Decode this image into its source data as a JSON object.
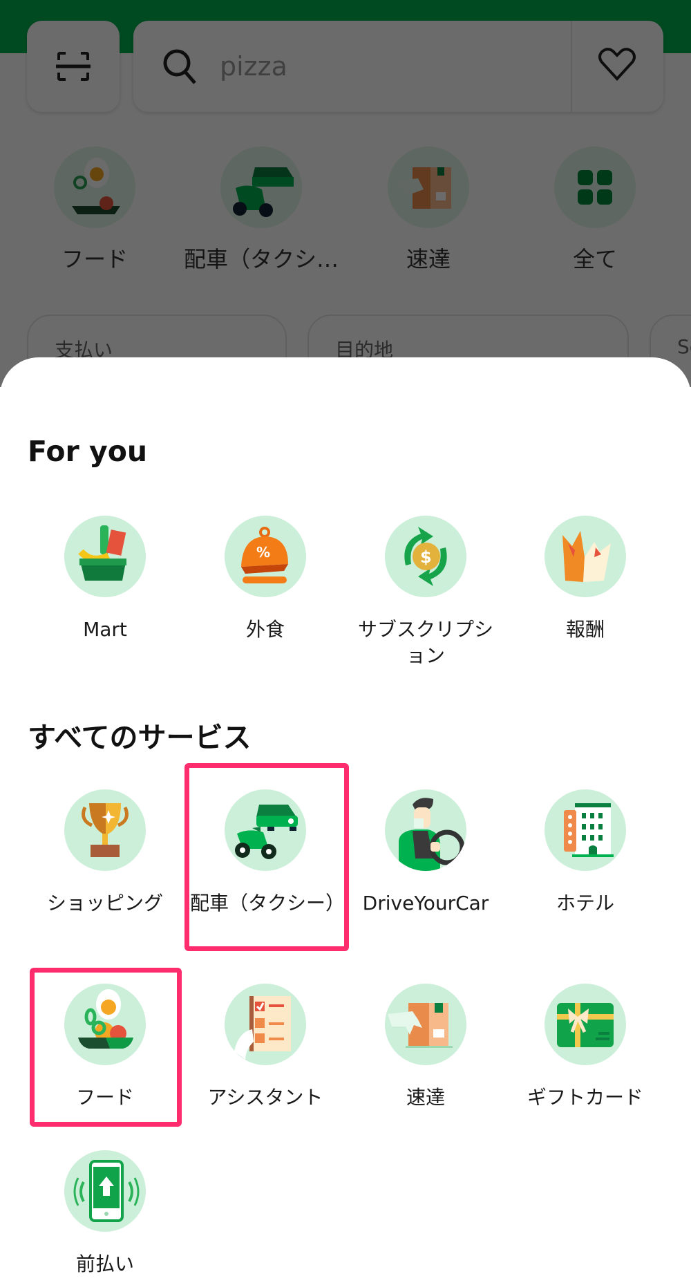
{
  "background": {
    "search": {
      "placeholder": "pizza",
      "icon": "search-icon"
    },
    "scan_icon": "scan-icon",
    "favorite_icon": "heart-icon",
    "quick_actions": [
      {
        "label": "フード",
        "icon": "food-icon"
      },
      {
        "label": "配車（タクシ…",
        "icon": "ride-icon"
      },
      {
        "label": "速達",
        "icon": "express-icon"
      },
      {
        "label": "全て",
        "icon": "grid-icon"
      }
    ],
    "cards": [
      {
        "label": "支払い"
      },
      {
        "label": "目的地"
      },
      {
        "label": "Se"
      }
    ],
    "colors": {
      "brand": "#00b14f"
    }
  },
  "sheet": {
    "for_you": {
      "title": "For you",
      "items": [
        {
          "label": "Mart",
          "icon": "mart-basket-icon"
        },
        {
          "label": "外食",
          "icon": "dine-out-cloche-icon"
        },
        {
          "label": "サブスクリプション",
          "icon": "subscription-coin-icon"
        },
        {
          "label": "報酬",
          "icon": "rewards-crown-icon"
        }
      ]
    },
    "all_services": {
      "title": "すべてのサービス",
      "items": [
        {
          "label": "ショッピング",
          "icon": "trophy-icon",
          "highlighted": false
        },
        {
          "label": "配車（タクシー）",
          "icon": "ride-icon",
          "highlighted": true
        },
        {
          "label": "DriveYourCar",
          "icon": "driver-icon",
          "highlighted": false
        },
        {
          "label": "ホテル",
          "icon": "hotel-icon",
          "highlighted": false
        },
        {
          "label": "フード",
          "icon": "food-icon",
          "highlighted": true
        },
        {
          "label": "アシスタント",
          "icon": "assistant-checklist-icon",
          "highlighted": false
        },
        {
          "label": "速達",
          "icon": "express-icon",
          "highlighted": false
        },
        {
          "label": "ギフトカード",
          "icon": "gift-card-icon",
          "highlighted": false
        },
        {
          "label": "前払い",
          "icon": "prepaid-phone-icon",
          "highlighted": false
        }
      ]
    },
    "colors": {
      "icon_bg": "#ccefd9",
      "highlight": "#ff2d6e"
    }
  }
}
